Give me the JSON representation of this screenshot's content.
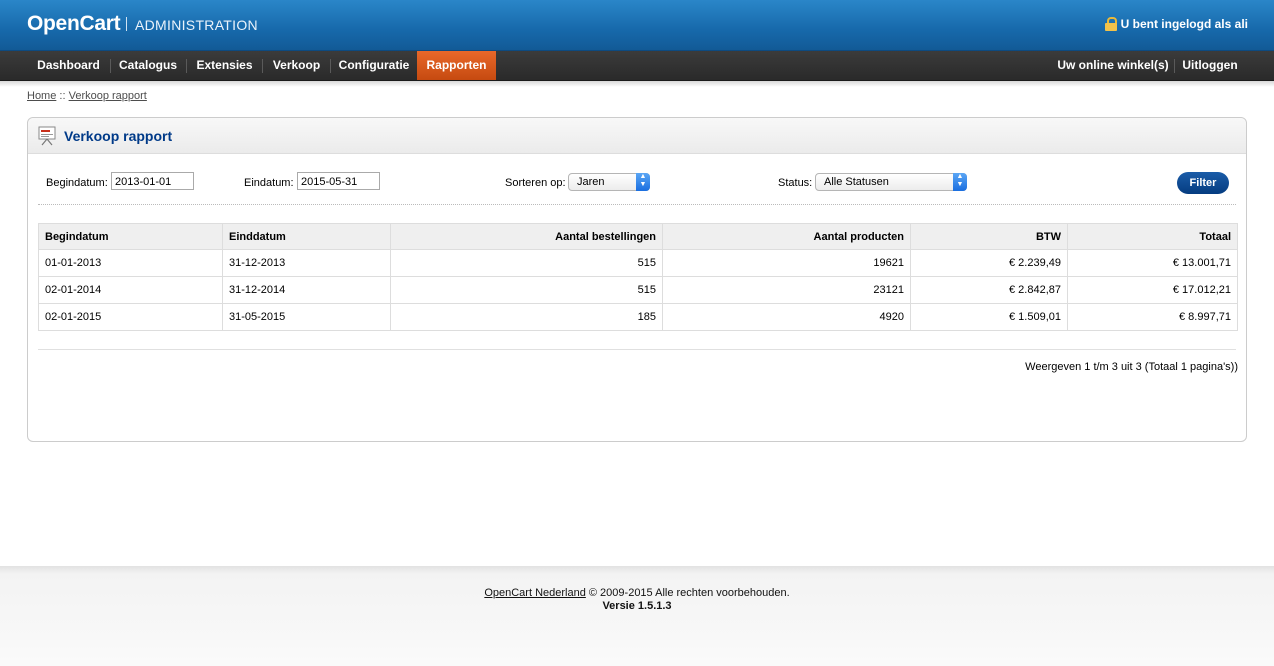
{
  "header": {
    "brand": "OpenCart",
    "section": "ADMINISTRATION",
    "login_text": "U bent ingelogd als ali"
  },
  "menu": {
    "left": [
      "Dashboard",
      "Catalogus",
      "Extensies",
      "Verkoop",
      "Configuratie",
      "Rapporten"
    ],
    "active": "Rapporten",
    "right": [
      "Uw online winkel(s)",
      "Uitloggen"
    ]
  },
  "breadcrumb": {
    "home": "Home",
    "separator": "::",
    "current": "Verkoop rapport"
  },
  "box": {
    "title": "Verkoop rapport"
  },
  "filters": {
    "start_label": "Begindatum:",
    "start_value": "2013-01-01",
    "end_label": "Eindatum:",
    "end_value": "2015-05-31",
    "sort_label": "Sorteren op:",
    "sort_value": "Jaren",
    "status_label": "Status:",
    "status_value": "Alle Statusen",
    "filter_button": "Filter"
  },
  "table": {
    "headers": [
      "Begindatum",
      "Einddatum",
      "Aantal bestellingen",
      "Aantal producten",
      "BTW",
      "Totaal"
    ],
    "rows": [
      [
        "01-01-2013",
        "31-12-2013",
        "515",
        "19621",
        "€ 2.239,49",
        "€ 13.001,71"
      ],
      [
        "02-01-2014",
        "31-12-2014",
        "515",
        "23121",
        "€ 2.842,87",
        "€ 17.012,21"
      ],
      [
        "02-01-2015",
        "31-05-2015",
        "185",
        "4920",
        "€ 1.509,01",
        "€ 8.997,71"
      ]
    ]
  },
  "pagination": "Weergeven 1 t/m 3 uit 3 (Totaal 1 pagina's))",
  "footer": {
    "link": "OpenCart Nederland",
    "copyright": " © 2009-2015 Alle rechten voorbehouden.",
    "version": "Versie 1.5.1.3"
  },
  "colors": {
    "header_blue": "#1769ab",
    "menu_dark": "#2f2f2f",
    "active_orange": "#d9571a",
    "title_blue": "#003a88",
    "button_blue": "#0a4a94"
  }
}
